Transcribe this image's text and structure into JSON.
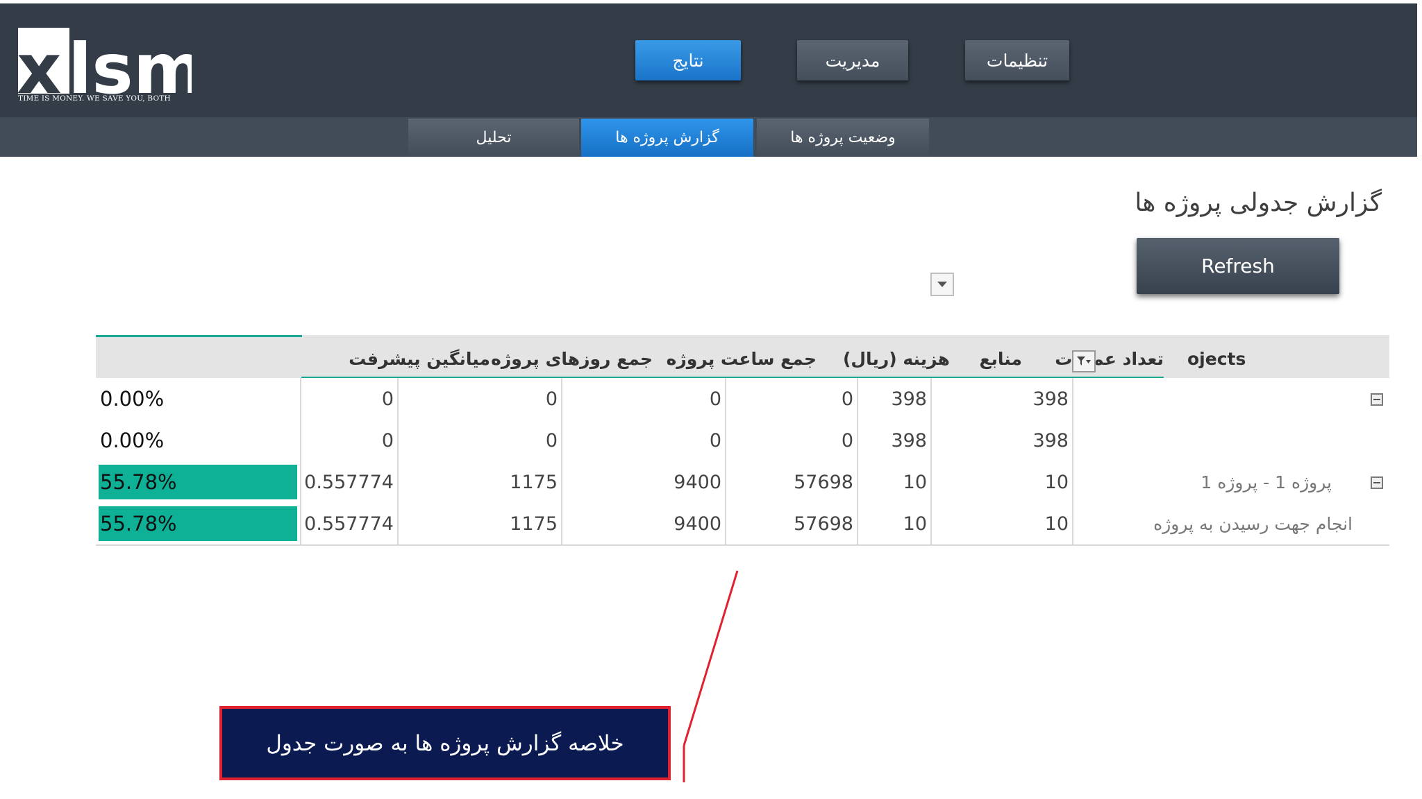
{
  "logo": {
    "text": "xlsm",
    "tagline": "TIME IS MONEY. WE SAVE YOU, BOTH"
  },
  "nav": {
    "settings": "تنظیمات",
    "management": "مدیریت",
    "results": "نتایج"
  },
  "subnav": {
    "project_status": "وضعیت پروژه ها",
    "project_report": "گزارش پروژه ها",
    "analysis": "تحلیل"
  },
  "page": {
    "title": "گزارش جدولی پروژه ها",
    "refresh_label": "Refresh"
  },
  "table": {
    "headers": {
      "projects": "ojects",
      "operations_count": "تعداد عملیات",
      "resources": "منابع",
      "cost": "هزینه (ریال)",
      "total_hours": "جمع ساعت پروژه",
      "total_days": "جمع روزهای پروژه",
      "avg_progress": "میانگین پیشرفت"
    },
    "rows": [
      {
        "label": "",
        "operations": "398",
        "resources": "398",
        "cost": "0",
        "hours": "0",
        "days": "0",
        "avg": "0",
        "pct_text": "0.00%",
        "pct": 0.0
      },
      {
        "label": "",
        "operations": "398",
        "resources": "398",
        "cost": "0",
        "hours": "0",
        "days": "0",
        "avg": "0",
        "pct_text": "0.00%",
        "pct": 0.0
      },
      {
        "label": "پروژه 1 - پروژه 1",
        "operations": "10",
        "resources": "10",
        "cost": "57698",
        "hours": "9400",
        "days": "1175",
        "avg": "0.557774",
        "pct_text": "55.78%",
        "pct": 0.5578
      },
      {
        "label": "انجام جهت رسیدن به پروژه",
        "operations": "10",
        "resources": "10",
        "cost": "57698",
        "hours": "9400",
        "days": "1175",
        "avg": "0.557774",
        "pct_text": "55.78%",
        "pct": 0.5578
      }
    ]
  },
  "callout": {
    "text": "خلاصه گزارش پروژه ها به صورت جدول"
  },
  "colors": {
    "header_bg": "#333c47",
    "accent_blue": "#1a74c9",
    "bar_green": "#0fb196",
    "callout_bg": "#0b1b52",
    "callout_border": "#e0212f"
  }
}
